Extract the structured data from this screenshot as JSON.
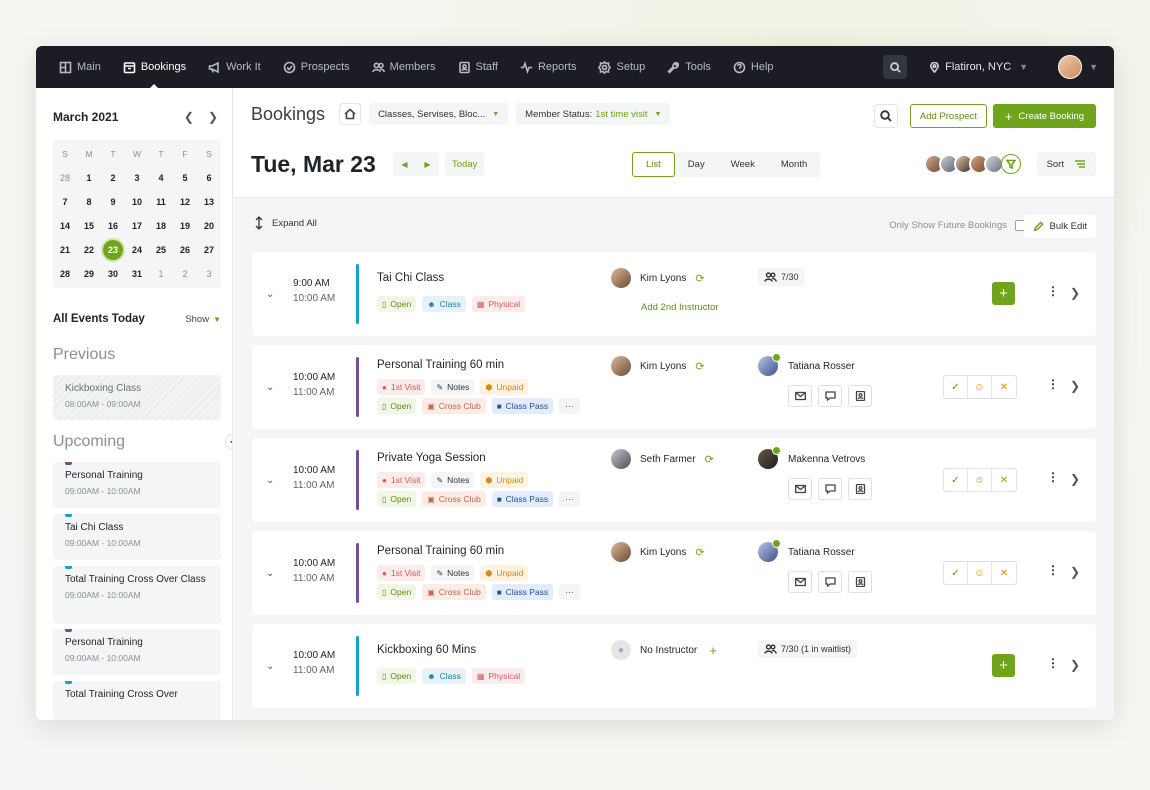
{
  "nav": {
    "items": [
      {
        "label": "Main",
        "icon": "grid-icon"
      },
      {
        "label": "Bookings",
        "icon": "calendar-icon"
      },
      {
        "label": "Work It",
        "icon": "megaphone-icon"
      },
      {
        "label": "Prospects",
        "icon": "check-circle-icon"
      },
      {
        "label": "Members",
        "icon": "users-icon"
      },
      {
        "label": "Staff",
        "icon": "id-card-icon"
      },
      {
        "label": "Reports",
        "icon": "pulse-icon"
      },
      {
        "label": "Setup",
        "icon": "gear-icon"
      },
      {
        "label": "Tools",
        "icon": "wrench-icon"
      },
      {
        "label": "Help",
        "icon": "question-icon"
      }
    ],
    "active": "Bookings",
    "location": "Flatiron, NYC"
  },
  "calendar": {
    "title": "March 2021",
    "dow": [
      "S",
      "M",
      "T",
      "W",
      "T",
      "F",
      "S"
    ],
    "weeks": [
      [
        "28",
        "1",
        "2",
        "3",
        "4",
        "5",
        "6"
      ],
      [
        "7",
        "8",
        "9",
        "10",
        "11",
        "12",
        "13"
      ],
      [
        "14",
        "15",
        "16",
        "17",
        "18",
        "19",
        "20"
      ],
      [
        "21",
        "22",
        "23",
        "24",
        "25",
        "26",
        "27"
      ],
      [
        "28",
        "29",
        "30",
        "31",
        "1",
        "2",
        "3"
      ]
    ],
    "today": "23"
  },
  "events": {
    "title": "All Events Today",
    "show_label": "Show",
    "previous_label": "Previous",
    "upcoming_label": "Upcoming",
    "previous": [
      {
        "name": "Kickboxing Class",
        "time": "08:00AM - 09:00AM"
      }
    ],
    "upcoming": [
      {
        "name": "Personal Training",
        "time": "09:00AM - 10:00AM",
        "color": "#7b4a8f"
      },
      {
        "name": "Tai Chi Class",
        "time": "09:00AM - 10:00AM",
        "color": "#1aa0c9"
      },
      {
        "name": "Total Training Cross Over Class",
        "time": "09:00AM - 10:00AM",
        "color": "#1aa0c9"
      },
      {
        "name": "Personal Training",
        "time": "09:00AM - 10:00AM",
        "color": "#7b4a8f"
      },
      {
        "name": "Total Training Cross Over",
        "time": "",
        "color": "#1aa0c9"
      }
    ]
  },
  "header": {
    "title": "Bookings",
    "filter_classes": "Classes, Servises, Bloc...",
    "member_status_label": "Member Status:",
    "member_status_value": "1st time visit",
    "add_prospect": "Add Prospect",
    "create_booking": "Create Booking",
    "date": "Tue, Mar 23",
    "today": "Today",
    "views": [
      "List",
      "Day",
      "Week",
      "Month"
    ],
    "active_view": "List",
    "sort": "Sort"
  },
  "toolbar": {
    "expand_all": "Expand All",
    "future_only": "Only Show Future Bookings",
    "bulk_edit": "Bulk Edit"
  },
  "bookings": [
    {
      "start": "9:00 AM",
      "end": "10:00 AM",
      "title": "Tai Chi Class",
      "color": "#1aa0c9",
      "tags1": [
        {
          "label": "Open",
          "kind": "open"
        },
        {
          "label": "Class",
          "kind": "class"
        },
        {
          "label": "Physical",
          "kind": "phys"
        }
      ],
      "instructor": "Kim Lyons",
      "add_instructor": "Add 2nd Instructor",
      "capacity": "7/30"
    },
    {
      "start": "10:00 AM",
      "end": "11:00 AM",
      "title": "Personal Training 60 min",
      "color": "#7b4a8f",
      "tags1": [
        {
          "label": "1st Visit",
          "kind": "visit"
        },
        {
          "label": "Notes",
          "kind": "notes"
        },
        {
          "label": "Unpaid",
          "kind": "unpaid"
        }
      ],
      "tags2": [
        {
          "label": "Open",
          "kind": "open"
        },
        {
          "label": "Cross Club",
          "kind": "cross"
        },
        {
          "label": "Class Pass",
          "kind": "pass"
        },
        {
          "label": "···",
          "kind": "more"
        }
      ],
      "instructor": "Kim Lyons",
      "member": "Tatiana Rosser"
    },
    {
      "start": "10:00 AM",
      "end": "11:00 AM",
      "title": "Private Yoga Session",
      "color": "#7b4a8f",
      "tags1": [
        {
          "label": "1st Visit",
          "kind": "visit"
        },
        {
          "label": "Notes",
          "kind": "notes"
        },
        {
          "label": "Unpaid",
          "kind": "unpaid"
        }
      ],
      "tags2": [
        {
          "label": "Open",
          "kind": "open"
        },
        {
          "label": "Cross Club",
          "kind": "cross"
        },
        {
          "label": "Class Pass",
          "kind": "pass"
        },
        {
          "label": "···",
          "kind": "more"
        }
      ],
      "instructor": "Seth Farmer",
      "member": "Makenna Vetrovs"
    },
    {
      "start": "10:00 AM",
      "end": "11:00 AM",
      "title": "Personal Training 60 min",
      "color": "#7b4a8f",
      "tags1": [
        {
          "label": "1st Visit",
          "kind": "visit"
        },
        {
          "label": "Notes",
          "kind": "notes"
        },
        {
          "label": "Unpaid",
          "kind": "unpaid"
        }
      ],
      "tags2": [
        {
          "label": "Open",
          "kind": "open"
        },
        {
          "label": "Cross Club",
          "kind": "cross"
        },
        {
          "label": "Class Pass",
          "kind": "pass"
        },
        {
          "label": "···",
          "kind": "more"
        }
      ],
      "instructor": "Kim Lyons",
      "member": "Tatiana Rosser"
    },
    {
      "start": "10:00 AM",
      "end": "11:00 AM",
      "title": "Kickboxing 60 Mins",
      "color": "#1aa0c9",
      "tags1": [
        {
          "label": "Open",
          "kind": "open"
        },
        {
          "label": "Class",
          "kind": "class"
        },
        {
          "label": "Physical",
          "kind": "phys"
        }
      ],
      "instructor": "No Instructor",
      "capacity": "7/30 (1 in waitlist)"
    }
  ],
  "colors": {
    "accent": "#6fa51a",
    "nav_bg": "#1c1d24",
    "purple": "#7b4a8f",
    "cyan": "#1aa0c9"
  }
}
